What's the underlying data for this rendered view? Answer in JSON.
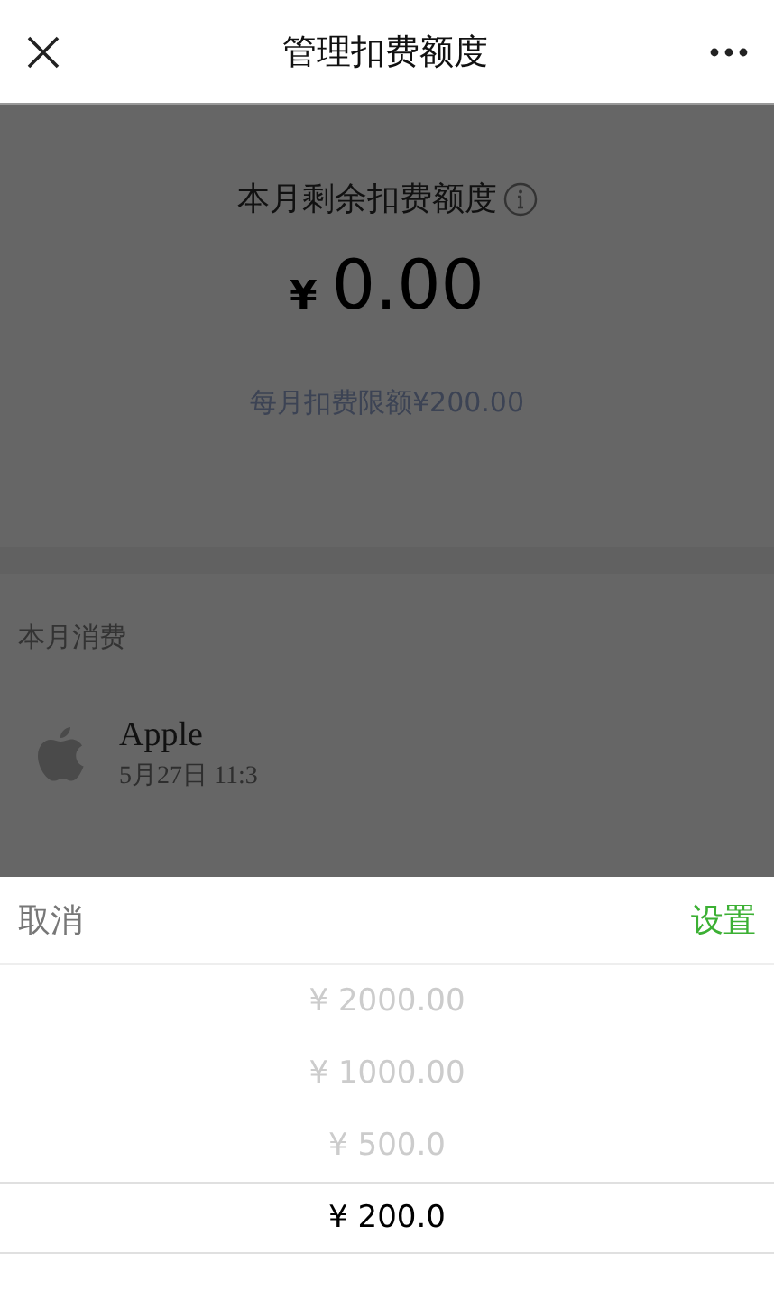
{
  "header": {
    "title": "管理扣费额度"
  },
  "summary": {
    "label": "本月剩余扣费额度",
    "currency": "¥",
    "amount": "0.00",
    "limit": "每月扣费限额¥200.00"
  },
  "consumption": {
    "title": "本月消费",
    "items": [
      {
        "merchant": "Apple",
        "time": "5月27日 11:3"
      }
    ]
  },
  "picker": {
    "cancel": "取消",
    "confirm": "设置",
    "options": [
      {
        "label": "¥ 2000.00",
        "selected": false
      },
      {
        "label": "¥ 1000.00",
        "selected": false
      },
      {
        "label": "¥ 500.0",
        "selected": false
      },
      {
        "label": "¥ 200.0",
        "selected": true
      }
    ]
  }
}
